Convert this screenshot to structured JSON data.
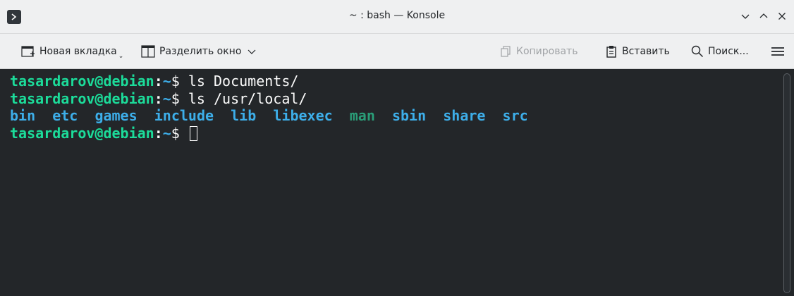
{
  "window": {
    "title": "~ : bash — Konsole"
  },
  "toolbar": {
    "new_tab_label": "Новая вкладка",
    "split_view_label": "Разделить окно",
    "copy_label": "Копировать",
    "paste_label": "Вставить",
    "search_label": "Поиск..."
  },
  "terminal": {
    "prompt_user": "tasardarov@debian",
    "prompt_colon": ":",
    "prompt_path": "~",
    "prompt_symbol": "$ ",
    "commands": [
      "ls Documents/",
      "ls /usr/local/"
    ],
    "output_dirs": [
      "bin",
      "etc",
      "games",
      "include",
      "lib",
      "libexec",
      "man",
      "sbin",
      "share",
      "src"
    ]
  },
  "colors": {
    "background": "#232629",
    "prompt_user": "#1cdc9a",
    "directory": "#3daee9",
    "man_dir": "#2a9d78",
    "text": "#fcfcfc"
  }
}
